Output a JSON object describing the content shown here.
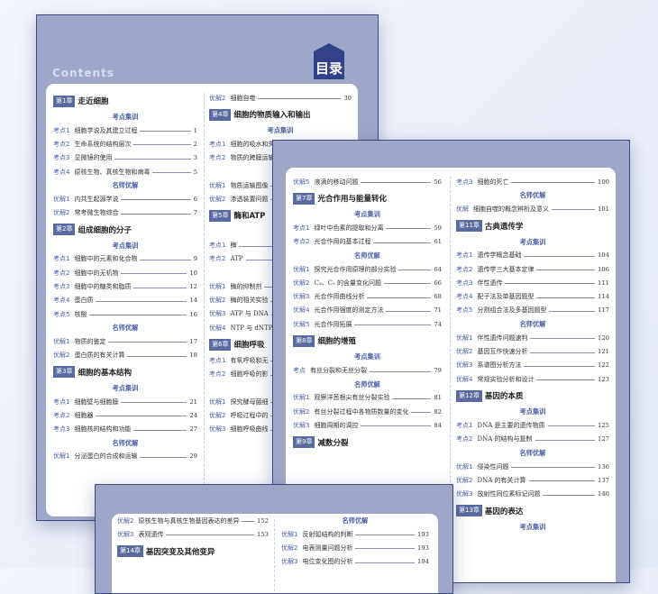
{
  "page1": {
    "contents_label": "Contents",
    "title": "目录",
    "left": [
      {
        "t": "ch",
        "box": "第1章",
        "title": "走近细胞"
      },
      {
        "t": "sec",
        "text": "考点集训"
      },
      {
        "t": "row",
        "lb": "考点1",
        "tx": "细胞学说及其建立过程",
        "pn": "1"
      },
      {
        "t": "row",
        "lb": "考点2",
        "tx": "生命系统的结构层次",
        "pn": "2"
      },
      {
        "t": "row",
        "lb": "考点3",
        "tx": "显微镜的使用",
        "pn": "3"
      },
      {
        "t": "row",
        "lb": "考点4",
        "tx": "原核生物、真核生物和病毒",
        "pn": "5"
      },
      {
        "t": "sec",
        "text": "名师优解"
      },
      {
        "t": "row",
        "lb": "优解1",
        "tx": "内共生起源学说",
        "pn": "6"
      },
      {
        "t": "row",
        "lb": "优解2",
        "tx": "常考微生物综合",
        "pn": "7"
      },
      {
        "t": "ch",
        "box": "第2章",
        "title": "组成细胞的分子"
      },
      {
        "t": "sec",
        "text": "考点集训"
      },
      {
        "t": "row",
        "lb": "考点1",
        "tx": "细胞中的元素和化合物",
        "pn": "9"
      },
      {
        "t": "row",
        "lb": "考点2",
        "tx": "细胞中的无机物",
        "pn": "10"
      },
      {
        "t": "row",
        "lb": "考点3",
        "tx": "细胞中的糖类和脂质",
        "pn": "12"
      },
      {
        "t": "row",
        "lb": "考点4",
        "tx": "蛋白质",
        "pn": "14"
      },
      {
        "t": "row",
        "lb": "考点5",
        "tx": "核酸",
        "pn": "16"
      },
      {
        "t": "sec",
        "text": "名师优解"
      },
      {
        "t": "row",
        "lb": "优解1",
        "tx": "物质的鉴定",
        "pn": "17"
      },
      {
        "t": "row",
        "lb": "优解2",
        "tx": "蛋白质的有关计算",
        "pn": "18"
      },
      {
        "t": "ch",
        "box": "第3章",
        "title": "细胞的基本结构"
      },
      {
        "t": "sec",
        "text": "考点集训"
      },
      {
        "t": "row",
        "lb": "考点1",
        "tx": "细胞壁与细胞膜",
        "pn": "21"
      },
      {
        "t": "row",
        "lb": "考点2",
        "tx": "细胞器",
        "pn": "24"
      },
      {
        "t": "row",
        "lb": "考点3",
        "tx": "细胞核的结构和功能",
        "pn": "27"
      },
      {
        "t": "sec",
        "text": "名师优解"
      },
      {
        "t": "row",
        "lb": "优解1",
        "tx": "分泌蛋白的合成和运输",
        "pn": "29"
      }
    ],
    "right": [
      {
        "t": "row",
        "lb": "优解2",
        "tx": "细胞自噬",
        "pn": "30"
      },
      {
        "t": "ch",
        "box": "第4章",
        "title": "细胞的物质输入和输出"
      },
      {
        "t": "sec",
        "text": "考点集训"
      },
      {
        "t": "row",
        "lb": "考点1",
        "tx": "细胞的吸水和失水",
        "pn": ""
      },
      {
        "t": "row",
        "lb": "考点2",
        "tx": "物质的跨膜运输",
        "pn": ""
      },
      {
        "t": "sec",
        "text": "名"
      },
      {
        "t": "row",
        "lb": "优解1",
        "tx": "物质运输图像",
        "pn": ""
      },
      {
        "t": "row",
        "lb": "优解2",
        "tx": "渗透装置问题",
        "pn": ""
      },
      {
        "t": "ch",
        "box": "第5章",
        "title": "酶和ATP"
      },
      {
        "t": "sec",
        "text": ""
      },
      {
        "t": "row",
        "lb": "考点1",
        "tx": "酶",
        "pn": ""
      },
      {
        "t": "row",
        "lb": "考点2",
        "tx": "ATP",
        "pn": ""
      },
      {
        "t": "sec",
        "text": "名"
      },
      {
        "t": "row",
        "lb": "优解1",
        "tx": "酶的抑制剂",
        "pn": ""
      },
      {
        "t": "row",
        "lb": "优解2",
        "tx": "酶的相关实验",
        "pn": ""
      },
      {
        "t": "row",
        "lb": "优解3",
        "tx": "ATP 与 DNA",
        "pn": ""
      },
      {
        "t": "row",
        "lb": "优解4",
        "tx": "NTP 与 dNTP",
        "pn": ""
      },
      {
        "t": "ch",
        "box": "第6章",
        "title": "细胞呼吸"
      },
      {
        "t": "row",
        "lb": "考点1",
        "tx": "有氧呼吸和无",
        "pn": ""
      },
      {
        "t": "row",
        "lb": "考点2",
        "tx": "细胞呼吸的影",
        "pn": ""
      },
      {
        "t": "sec",
        "text": ""
      },
      {
        "t": "row",
        "lb": "优解1",
        "tx": "探究酵母菌细",
        "pn": ""
      },
      {
        "t": "row",
        "lb": "优解2",
        "tx": "呼吸过程中的",
        "pn": ""
      },
      {
        "t": "row",
        "lb": "优解3",
        "tx": "细胞呼吸曲线",
        "pn": ""
      }
    ]
  },
  "page2": {
    "left": [
      {
        "t": "row",
        "lb": "优解5",
        "tx": "液滴的移动问题",
        "pn": "56"
      },
      {
        "t": "ch",
        "box": "第7章",
        "title": "光合作用与能量转化"
      },
      {
        "t": "sec",
        "text": "考点集训"
      },
      {
        "t": "row",
        "lb": "考点1",
        "tx": "绿叶中色素的提取和分离",
        "pn": "59"
      },
      {
        "t": "row",
        "lb": "考点2",
        "tx": "光合作用的基本过程",
        "pn": "61"
      },
      {
        "t": "sec",
        "text": "名师优解"
      },
      {
        "t": "row",
        "lb": "优解1",
        "tx": "探究光合作用原理的部分实验",
        "pn": "64"
      },
      {
        "t": "row",
        "lb": "优解2",
        "tx": "C₃、C₅ 的含量变化问题",
        "pn": "66"
      },
      {
        "t": "row",
        "lb": "优解3",
        "tx": "光合作用曲线分析",
        "pn": "68"
      },
      {
        "t": "row",
        "lb": "优解4",
        "tx": "光合作用强度的测定方法",
        "pn": "71"
      },
      {
        "t": "row",
        "lb": "优解5",
        "tx": "光合作用拓展",
        "pn": "74"
      },
      {
        "t": "ch",
        "box": "第8章",
        "title": "细胞的增殖"
      },
      {
        "t": "sec",
        "text": "考点集训"
      },
      {
        "t": "row",
        "lb": "考点",
        "tx": "有丝分裂和无丝分裂",
        "pn": "79"
      },
      {
        "t": "sec",
        "text": "名师优解"
      },
      {
        "t": "row",
        "lb": "优解1",
        "tx": "观察洋葱根尖有丝分裂实验",
        "pn": "81"
      },
      {
        "t": "row",
        "lb": "优解2",
        "tx": "有丝分裂过程中各物质数量的变化",
        "pn": "82"
      },
      {
        "t": "row",
        "lb": "优解3",
        "tx": "细胞周期的调控",
        "pn": "84"
      },
      {
        "t": "ch",
        "box": "第9章",
        "title": "减数分裂"
      }
    ],
    "right": [
      {
        "t": "row",
        "lb": "考点3",
        "tx": "细胞的死亡",
        "pn": "100"
      },
      {
        "t": "sec",
        "text": "名师优解"
      },
      {
        "t": "row",
        "lb": "优解",
        "tx": "细胞自噬的概念辨析及意义",
        "pn": "101"
      },
      {
        "t": "ch",
        "box": "第11章",
        "title": "古典遗传学"
      },
      {
        "t": "sec",
        "text": "考点集训"
      },
      {
        "t": "row",
        "lb": "考点1",
        "tx": "遗传学概念基础",
        "pn": "104"
      },
      {
        "t": "row",
        "lb": "考点2",
        "tx": "遗传学三大基本定律",
        "pn": "106"
      },
      {
        "t": "row",
        "lb": "考点3",
        "tx": "伴性遗传",
        "pn": "111"
      },
      {
        "t": "row",
        "lb": "考点4",
        "tx": "配子法及单基因题型",
        "pn": "114"
      },
      {
        "t": "row",
        "lb": "考点5",
        "tx": "分割组合法及多基因题型",
        "pn": "117"
      },
      {
        "t": "sec",
        "text": "名师优解"
      },
      {
        "t": "row",
        "lb": "优解1",
        "tx": "伴性遗传问题速判",
        "pn": "120"
      },
      {
        "t": "row",
        "lb": "优解2",
        "tx": "基因互作快速分析",
        "pn": "121"
      },
      {
        "t": "row",
        "lb": "优解3",
        "tx": "系谱图分析方法",
        "pn": "122"
      },
      {
        "t": "row",
        "lb": "优解4",
        "tx": "常规实验分析和设计",
        "pn": "123"
      },
      {
        "t": "ch",
        "box": "第12章",
        "title": "基因的本质"
      },
      {
        "t": "sec",
        "text": "考点集训"
      },
      {
        "t": "row",
        "lb": "考点1",
        "tx": "DNA 是主要的遗传物质",
        "pn": "125"
      },
      {
        "t": "row",
        "lb": "考点2",
        "tx": "DNA 的结构与复制",
        "pn": "127"
      },
      {
        "t": "sec",
        "text": "名师优解"
      },
      {
        "t": "row",
        "lb": "优解1",
        "tx": "侵染性问题",
        "pn": "136"
      },
      {
        "t": "row",
        "lb": "优解2",
        "tx": "DNA 的有关计算",
        "pn": "137"
      },
      {
        "t": "row",
        "lb": "优解3",
        "tx": "放射性同位素标记问题",
        "pn": "140"
      },
      {
        "t": "ch",
        "box": "第13章",
        "title": "基因的表达"
      },
      {
        "t": "sec",
        "text": "考点集训"
      }
    ]
  },
  "page3": {
    "left": [
      {
        "t": "row",
        "lb": "优解2",
        "tx": "原核生物与真核生物基因表达的差异",
        "pn": "152"
      },
      {
        "t": "row",
        "lb": "优解3",
        "tx": "表观遗传",
        "pn": "153"
      },
      {
        "t": "ch",
        "box": "第14章",
        "title": "基因突变及其他变异"
      }
    ],
    "right": [
      {
        "t": "sec",
        "text": "名师优解"
      },
      {
        "t": "row",
        "lb": "优解1",
        "tx": "反射弧结构的判断",
        "pn": "193"
      },
      {
        "t": "row",
        "lb": "优解2",
        "tx": "电表测量问题分析",
        "pn": "193"
      },
      {
        "t": "row",
        "lb": "优解3",
        "tx": "电位变化图的分析",
        "pn": "194"
      }
    ]
  },
  "colors": {
    "frame": "#9fa7c8",
    "border": "#3d4a85",
    "accent": "#4a5fa5",
    "chapter_box": "#5a6aa0"
  }
}
